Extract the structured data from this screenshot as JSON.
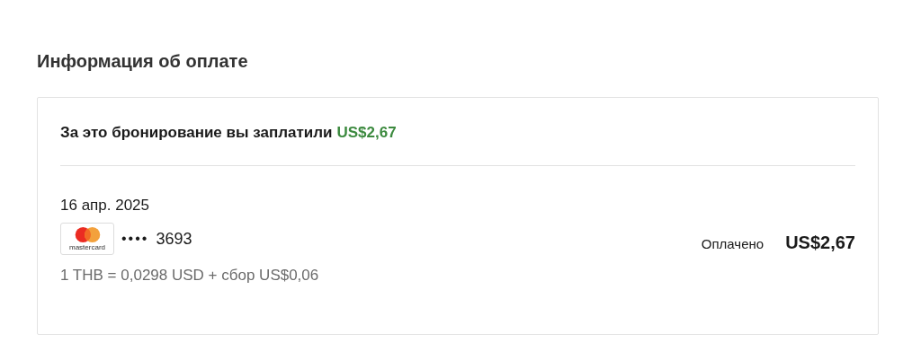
{
  "section_title": "Информация об оплате",
  "summary": {
    "text": "За это бронирование вы заплатили",
    "amount": "US$2,67"
  },
  "payment": {
    "date": "16 апр. 2025",
    "card_brand": "mastercard",
    "card_dots": "••••",
    "card_last4": "3693",
    "rate": "1 THB = 0,0298 USD + сбор US$0,06",
    "status": "Оплачено",
    "amount": "US$2,67"
  }
}
